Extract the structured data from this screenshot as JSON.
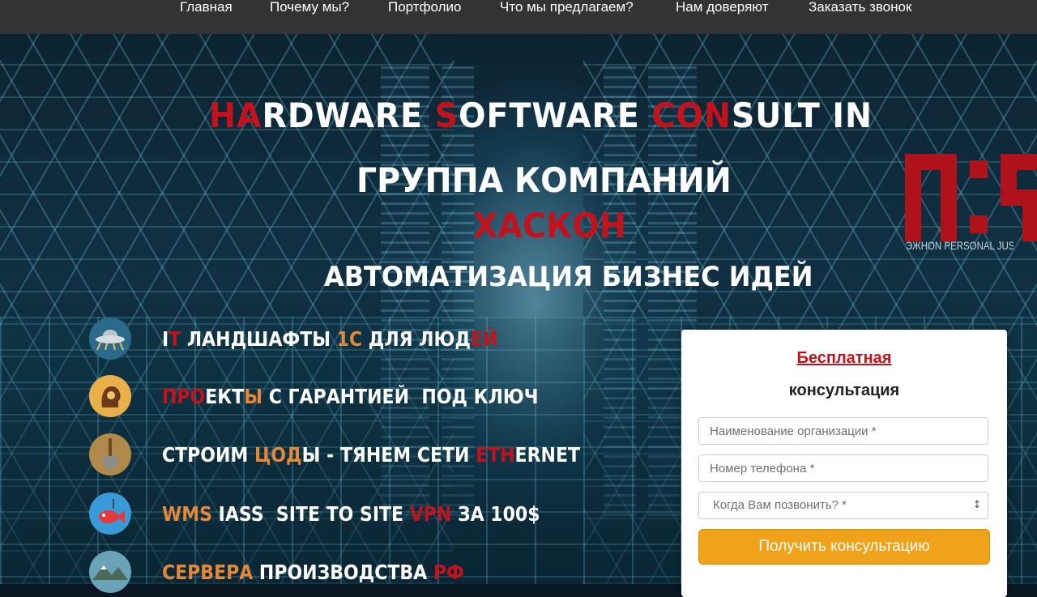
{
  "nav": {
    "items": [
      {
        "label": "Главная"
      },
      {
        "label": "Почему мы?"
      },
      {
        "label": "Портфолио"
      },
      {
        "label": "Что мы предлагаем?"
      },
      {
        "label": "Нам доверяют"
      },
      {
        "label": "Заказать звонок"
      }
    ]
  },
  "hero": {
    "brand_parts": [
      {
        "text": "HA",
        "color": "red"
      },
      {
        "text": "RDWARE ",
        "color": "white"
      },
      {
        "text": "S",
        "color": "red"
      },
      {
        "text": "OFTWARE ",
        "color": "white"
      },
      {
        "text": "CON",
        "color": "red"
      },
      {
        "text": "SULT IN",
        "color": "white"
      }
    ],
    "group_title": "ГРУППА КОМПАНИЙ",
    "company_name": "ХАСКОН",
    "tagline": "АВТОМАТИЗАЦИЯ БИЗНЕС ИДЕЙ",
    "logo_caption": "ЭЖНОN PERSONAL JUST",
    "colors": {
      "red": "#c4121c",
      "orange": "#e3873a",
      "white": "#ffffff",
      "accent_button": "#f0a21b"
    }
  },
  "features": [
    {
      "icon": "ufo-icon",
      "parts": [
        {
          "text": "I",
          "color": "white"
        },
        {
          "text": "T",
          "color": "red"
        },
        {
          "text": " ЛАНДШАФТЫ ",
          "color": "white"
        },
        {
          "text": "1С",
          "color": "orange"
        },
        {
          "text": " ДЛЯ ЛЮД",
          "color": "white"
        },
        {
          "text": "ЕЙ",
          "color": "red"
        }
      ]
    },
    {
      "icon": "head-gear-icon",
      "parts": [
        {
          "text": "ПРО",
          "color": "red"
        },
        {
          "text": "ЕКТ",
          "color": "white"
        },
        {
          "text": "Ы",
          "color": "orange"
        },
        {
          "text": " С ГАРАНТИЕЙ  ПОД КЛЮЧ",
          "color": "white"
        }
      ]
    },
    {
      "icon": "shovel-icon",
      "parts": [
        {
          "text": "СТРОИМ ",
          "color": "white"
        },
        {
          "text": "ЦОД",
          "color": "orange"
        },
        {
          "text": "Ы - ТЯНЕМ СЕТИ ",
          "color": "white"
        },
        {
          "text": "ETH",
          "color": "red"
        },
        {
          "text": "ERNET",
          "color": "white"
        }
      ]
    },
    {
      "icon": "fish-icon",
      "parts": [
        {
          "text": "WMS",
          "color": "orange"
        },
        {
          "text": " IASS  SITE TO SITE ",
          "color": "white"
        },
        {
          "text": "VPN",
          "color": "red"
        },
        {
          "text": " ЗА 100$",
          "color": "white"
        }
      ]
    },
    {
      "icon": "mountains-icon",
      "parts": [
        {
          "text": "СЕРВЕРА",
          "color": "orange"
        },
        {
          "text": " ПРОИЗВОДСТВА ",
          "color": "white"
        },
        {
          "text": "РФ",
          "color": "red"
        }
      ]
    }
  ],
  "form": {
    "title": "Бесплатная",
    "subtitle": "консультация",
    "org_placeholder": "Наименование организации *",
    "phone_placeholder": "Номер телефона *",
    "call_time_selected": "Когда Вам позвонить? *",
    "submit_label": "Получить консультацию"
  }
}
